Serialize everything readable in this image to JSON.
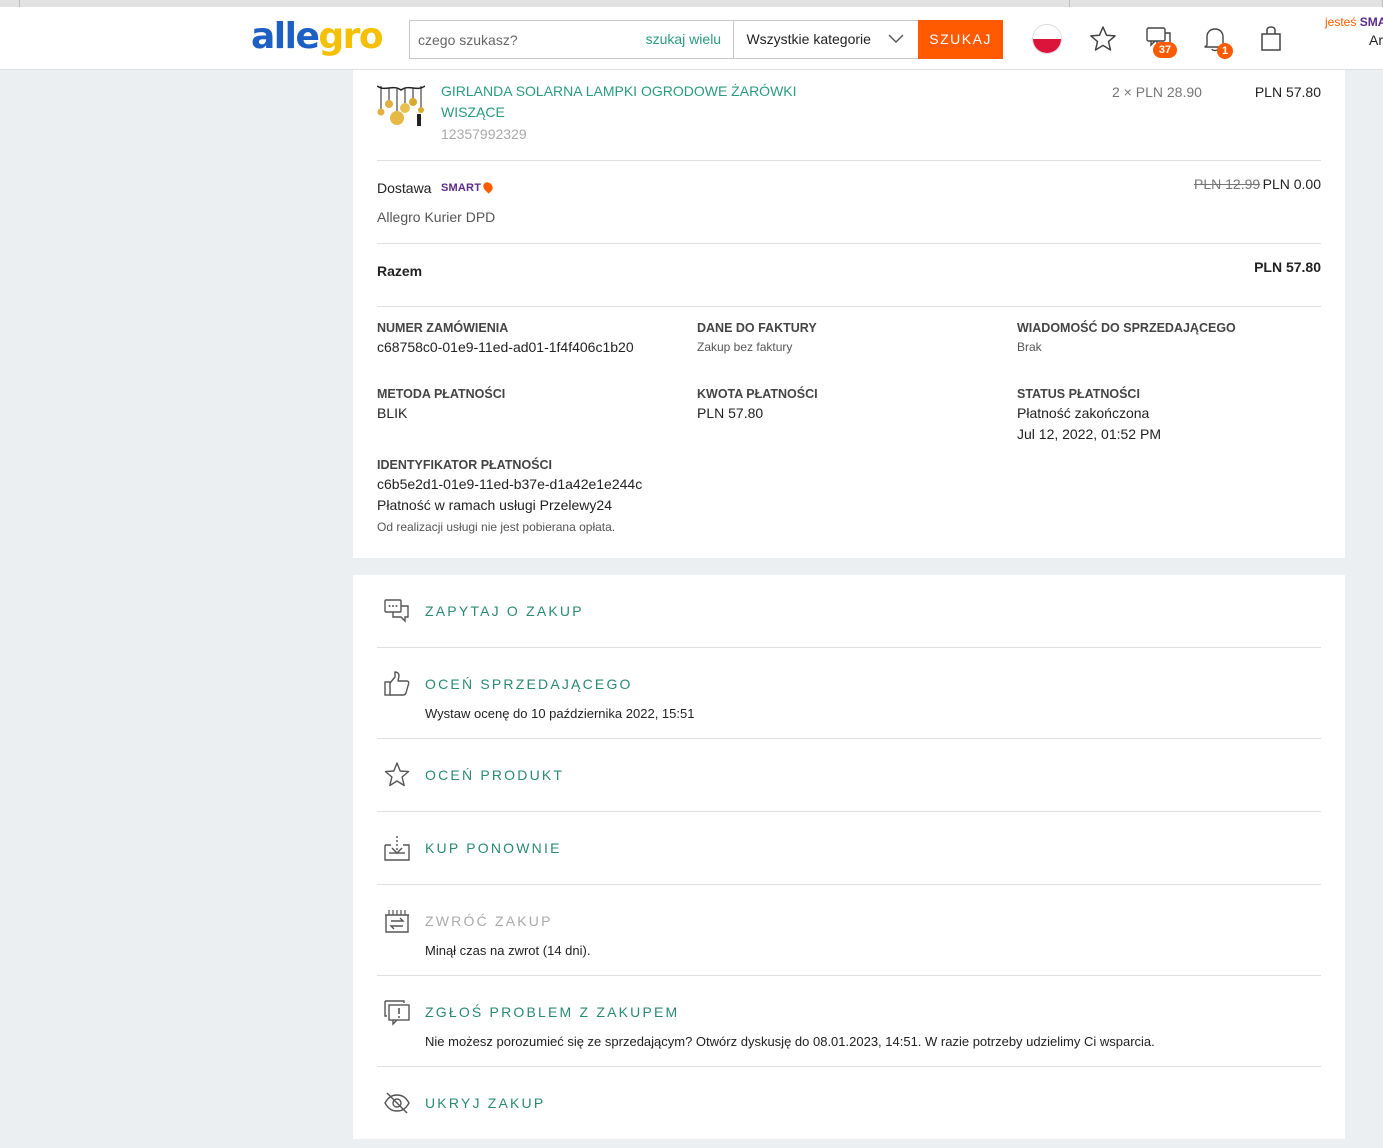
{
  "header": {
    "logo_part1": "alle",
    "logo_part2": "gro",
    "search_placeholder": "czego szukasz?",
    "search_many": "szukaj wielu",
    "category": "Wszystkie kategorie",
    "search_button": "SZUKAJ",
    "messages_badge": "37",
    "notifications_badge": "1",
    "smart_prefix": "jesteś",
    "smart_label": "SMA",
    "user_partial": "Ar"
  },
  "order": {
    "product_title": "GIRLANDA SOLARNA LAMPKI OGRODOWE ŻARÓWKI WISZĄCE",
    "product_id": "12357992329",
    "product_qty": "2 × PLN 28.90",
    "product_sum": "PLN 57.80",
    "delivery_label": "Dostawa",
    "smart_badge": "SMART",
    "delivery_carrier": "Allegro Kurier DPD",
    "delivery_old_price": "PLN 12.99",
    "delivery_price": "PLN 0.00",
    "total_label": "Razem",
    "total_value": "PLN 57.80"
  },
  "details": {
    "order_number_label": "NUMER ZAMÓWIENIA",
    "order_number": "c68758c0-01e9-11ed-ad01-1f4f406c1b20",
    "invoice_label": "DANE DO FAKTURY",
    "invoice_value": "Zakup bez faktury",
    "message_label": "WIADOMOŚĆ DO SPRZEDAJĄCEGO",
    "message_value": "Brak",
    "payment_method_label": "METODA PŁATNOŚCI",
    "payment_method": "BLIK",
    "payment_amount_label": "KWOTA PŁATNOŚCI",
    "payment_amount": "PLN 57.80",
    "payment_status_label": "STATUS PŁATNOŚCI",
    "payment_status": "Płatność zakończona",
    "payment_date": "Jul 12, 2022, 01:52 PM",
    "payment_id_label": "IDENTYFIKATOR PŁATNOŚCI",
    "payment_id": "c6b5e2d1-01e9-11ed-b37e-d1a42e1e244c",
    "payment_service": "Płatność w ramach usługi Przelewy24",
    "payment_fee_note": "Od realizacji usługi nie jest pobierana opłata."
  },
  "actions": [
    {
      "title": "ZAPYTAJ O ZAKUP",
      "icon": "chat-icon",
      "subtitle": ""
    },
    {
      "title": "OCEŃ SPRZEDAJĄCEGO",
      "icon": "thumbs-up-icon",
      "subtitle": "Wystaw ocenę do 10 października 2022, 15:51"
    },
    {
      "title": "OCEŃ PRODUKT",
      "icon": "star-icon",
      "subtitle": ""
    },
    {
      "title": "KUP PONOWNIE",
      "icon": "buy-again-icon",
      "subtitle": ""
    },
    {
      "title": "ZWRÓĆ ZAKUP",
      "icon": "return-icon",
      "subtitle": "Minął czas na zwrot (14 dni)."
    },
    {
      "title": "ZGŁOŚ PROBLEM Z ZAKUPEM",
      "icon": "report-problem-icon",
      "subtitle": "Nie możesz porozumieć się ze sprzedającym? Otwórz dyskusję do 08.01.2023, 14:51. W razie potrzeby udzielimy Ci wsparcia."
    },
    {
      "title": "UKRYJ ZAKUP",
      "icon": "eye-hidden-icon",
      "subtitle": ""
    }
  ],
  "colors": {
    "accent": "#2a9b7e",
    "brand_orange": "#ff5a00",
    "logo_blue": "#1d5fc2",
    "logo_yellow": "#f4c000"
  }
}
